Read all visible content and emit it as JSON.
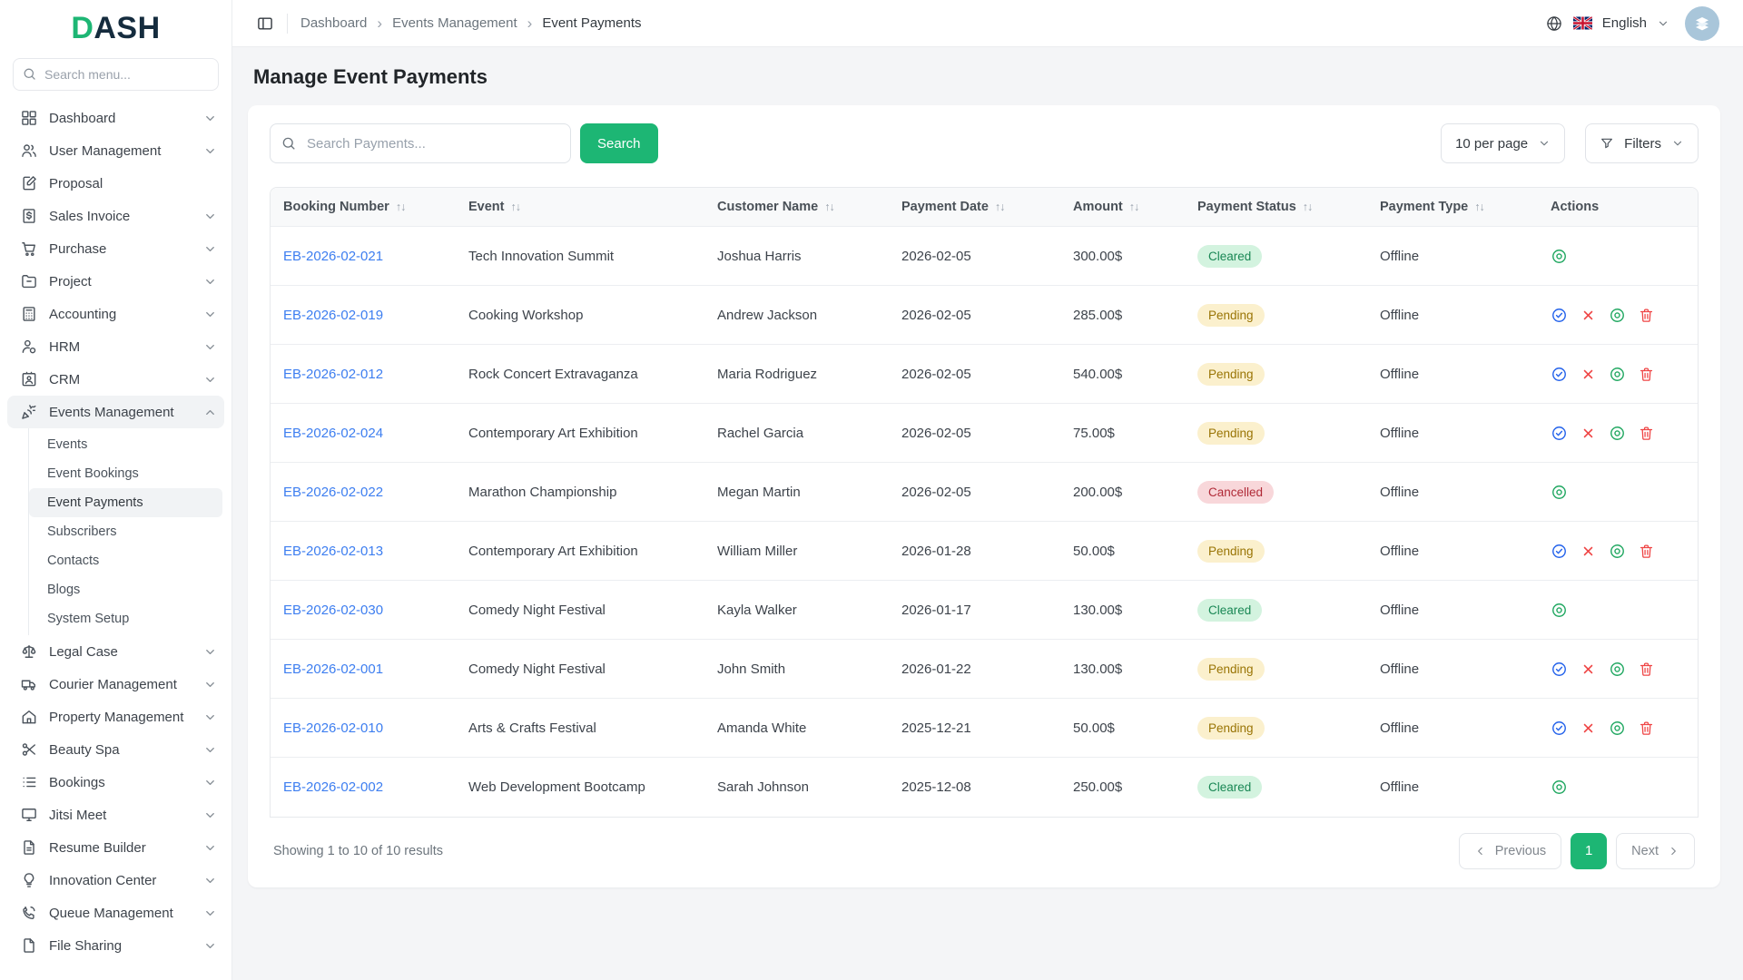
{
  "brand": {
    "logo_primary": "D",
    "logo_secondary": "ASH"
  },
  "colors": {
    "primary_green": "#1db674",
    "link_blue": "#3d7ef0",
    "sidebar_active_bg": "#f1f3f5",
    "avatar_bg": "#a9c6da",
    "action_approve": "#2563eb",
    "action_reject": "#ef4444",
    "action_view": "#22a862",
    "action_delete": "#ef4444"
  },
  "sidebar": {
    "search_placeholder": "Search menu...",
    "items": [
      {
        "label": "Dashboard",
        "icon": "grid",
        "chevron": "down"
      },
      {
        "label": "User Management",
        "icon": "users",
        "chevron": "down"
      },
      {
        "label": "Proposal",
        "icon": "proposal",
        "chevron": null
      },
      {
        "label": "Sales Invoice",
        "icon": "invoice",
        "chevron": "down"
      },
      {
        "label": "Purchase",
        "icon": "cart",
        "chevron": "down"
      },
      {
        "label": "Project",
        "icon": "folder",
        "chevron": "down"
      },
      {
        "label": "Accounting",
        "icon": "calculator",
        "chevron": "down"
      },
      {
        "label": "HRM",
        "icon": "hrm",
        "chevron": "down"
      },
      {
        "label": "CRM",
        "icon": "id-card",
        "chevron": "down"
      },
      {
        "label": "Events Management",
        "icon": "party",
        "chevron": "up",
        "active": true,
        "children": [
          {
            "label": "Events"
          },
          {
            "label": "Event Bookings"
          },
          {
            "label": "Event Payments",
            "active": true
          },
          {
            "label": "Subscribers"
          },
          {
            "label": "Contacts"
          },
          {
            "label": "Blogs"
          },
          {
            "label": "System Setup"
          }
        ]
      },
      {
        "label": "Legal Case",
        "icon": "scales",
        "chevron": "down"
      },
      {
        "label": "Courier Management",
        "icon": "truck",
        "chevron": "down"
      },
      {
        "label": "Property Management",
        "icon": "property",
        "chevron": "down"
      },
      {
        "label": "Beauty Spa",
        "icon": "scissors",
        "chevron": "down"
      },
      {
        "label": "Bookings",
        "icon": "list",
        "chevron": "down"
      },
      {
        "label": "Jitsi Meet",
        "icon": "monitor",
        "chevron": "down"
      },
      {
        "label": "Resume Builder",
        "icon": "resume",
        "chevron": "down"
      },
      {
        "label": "Innovation Center",
        "icon": "bulb",
        "chevron": "down"
      },
      {
        "label": "Queue Management",
        "icon": "phone",
        "chevron": "down"
      },
      {
        "label": "File Sharing",
        "icon": "file",
        "chevron": "down"
      }
    ]
  },
  "topbar": {
    "breadcrumb": [
      "Dashboard",
      "Events Management",
      "Event Payments"
    ],
    "language": "English"
  },
  "page": {
    "title": "Manage Event Payments"
  },
  "toolbar": {
    "search_placeholder": "Search Payments...",
    "search_button": "Search",
    "per_page": "10 per page",
    "filters": "Filters"
  },
  "table": {
    "columns": [
      {
        "label": "Booking Number",
        "sortable": true
      },
      {
        "label": "Event",
        "sortable": true
      },
      {
        "label": "Customer Name",
        "sortable": true
      },
      {
        "label": "Payment Date",
        "sortable": true
      },
      {
        "label": "Amount",
        "sortable": true
      },
      {
        "label": "Payment Status",
        "sortable": true
      },
      {
        "label": "Payment Type",
        "sortable": true
      },
      {
        "label": "Actions",
        "sortable": false
      }
    ],
    "status_styles": {
      "Cleared": {
        "bg": "#d3f3df",
        "text": "#198754"
      },
      "Pending": {
        "bg": "#fbf0cd",
        "text": "#997404"
      },
      "Cancelled": {
        "bg": "#f8d7da",
        "text": "#b02a37"
      }
    },
    "rows": [
      {
        "booking": "EB-2026-02-021",
        "event": "Tech Innovation Summit",
        "customer": "Joshua Harris",
        "date": "2026-02-05",
        "amount": "300.00$",
        "status": "Cleared",
        "type": "Offline",
        "actions": [
          "view"
        ]
      },
      {
        "booking": "EB-2026-02-019",
        "event": "Cooking Workshop",
        "customer": "Andrew Jackson",
        "date": "2026-02-05",
        "amount": "285.00$",
        "status": "Pending",
        "type": "Offline",
        "actions": [
          "approve",
          "reject",
          "view",
          "delete"
        ]
      },
      {
        "booking": "EB-2026-02-012",
        "event": "Rock Concert Extravaganza",
        "customer": "Maria Rodriguez",
        "date": "2026-02-05",
        "amount": "540.00$",
        "status": "Pending",
        "type": "Offline",
        "actions": [
          "approve",
          "reject",
          "view",
          "delete"
        ]
      },
      {
        "booking": "EB-2026-02-024",
        "event": "Contemporary Art Exhibition",
        "customer": "Rachel Garcia",
        "date": "2026-02-05",
        "amount": "75.00$",
        "status": "Pending",
        "type": "Offline",
        "actions": [
          "approve",
          "reject",
          "view",
          "delete"
        ]
      },
      {
        "booking": "EB-2026-02-022",
        "event": "Marathon Championship",
        "customer": "Megan Martin",
        "date": "2026-02-05",
        "amount": "200.00$",
        "status": "Cancelled",
        "type": "Offline",
        "actions": [
          "view"
        ]
      },
      {
        "booking": "EB-2026-02-013",
        "event": "Contemporary Art Exhibition",
        "customer": "William Miller",
        "date": "2026-01-28",
        "amount": "50.00$",
        "status": "Pending",
        "type": "Offline",
        "actions": [
          "approve",
          "reject",
          "view",
          "delete"
        ]
      },
      {
        "booking": "EB-2026-02-030",
        "event": "Comedy Night Festival",
        "customer": "Kayla Walker",
        "date": "2026-01-17",
        "amount": "130.00$",
        "status": "Cleared",
        "type": "Offline",
        "actions": [
          "view"
        ]
      },
      {
        "booking": "EB-2026-02-001",
        "event": "Comedy Night Festival",
        "customer": "John Smith",
        "date": "2026-01-22",
        "amount": "130.00$",
        "status": "Pending",
        "type": "Offline",
        "actions": [
          "approve",
          "reject",
          "view",
          "delete"
        ]
      },
      {
        "booking": "EB-2026-02-010",
        "event": "Arts & Crafts Festival",
        "customer": "Amanda White",
        "date": "2025-12-21",
        "amount": "50.00$",
        "status": "Pending",
        "type": "Offline",
        "actions": [
          "approve",
          "reject",
          "view",
          "delete"
        ]
      },
      {
        "booking": "EB-2026-02-002",
        "event": "Web Development Bootcamp",
        "customer": "Sarah Johnson",
        "date": "2025-12-08",
        "amount": "250.00$",
        "status": "Cleared",
        "type": "Offline",
        "actions": [
          "view"
        ]
      }
    ]
  },
  "footer": {
    "summary": "Showing 1 to 10 of 10 results",
    "previous": "Previous",
    "page": "1",
    "next": "Next"
  }
}
